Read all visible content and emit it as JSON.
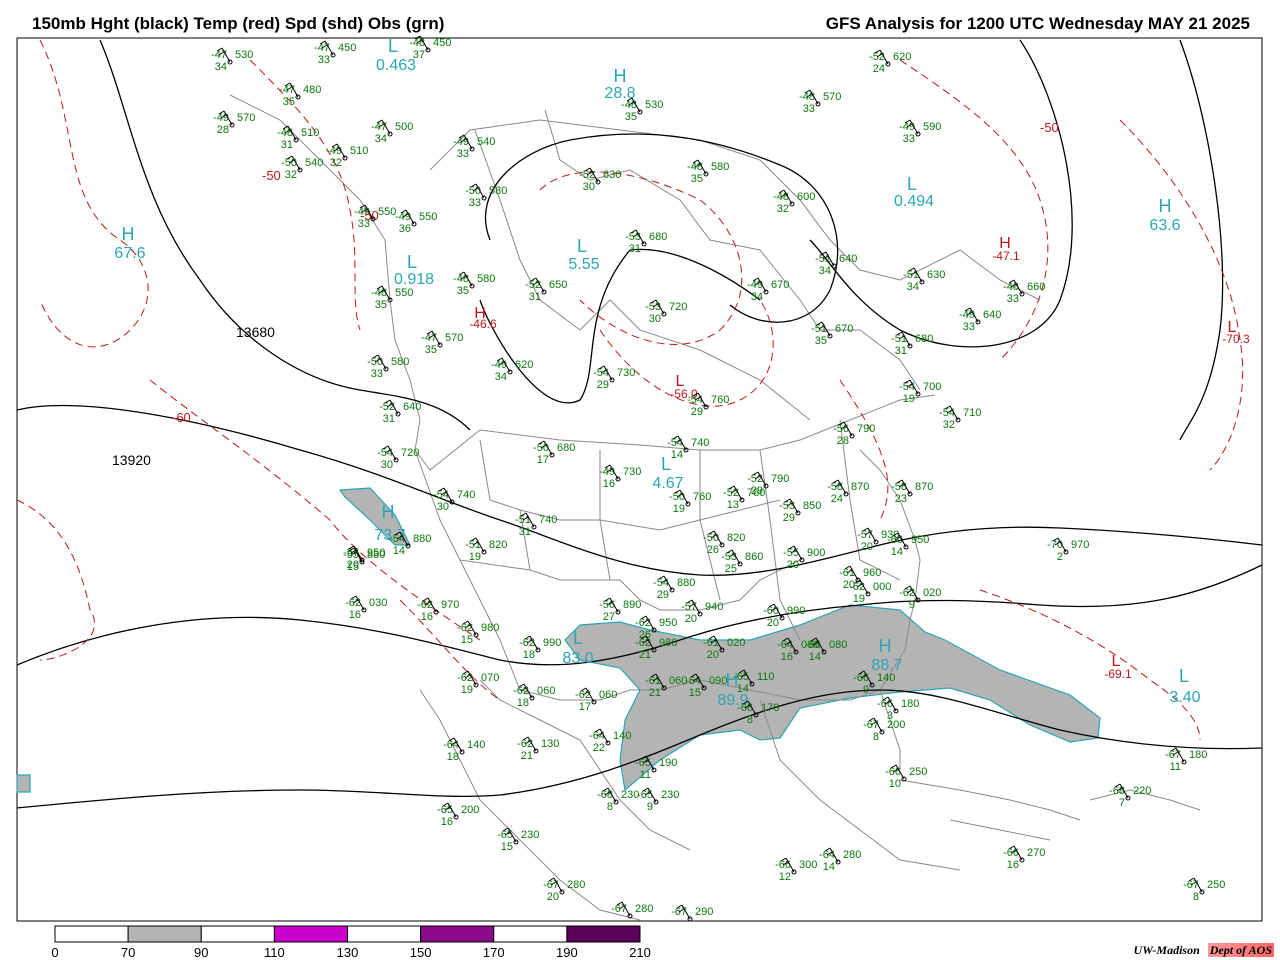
{
  "header": {
    "left_title": "150mb Hght (black) Temp (red) Spd (shd) Obs (grn)",
    "right_title": "GFS Analysis for 1200 UTC Wednesday  MAY 21 2025"
  },
  "contour_labels": [
    {
      "text": "13680"
    },
    {
      "text": "13920"
    }
  ],
  "temp_labels": [
    {
      "text": "-50"
    },
    {
      "text": "-50"
    },
    {
      "text": "-60"
    },
    {
      "text": "-50"
    }
  ],
  "centers": [
    {
      "letter": "H",
      "value": "67.6",
      "color": "#2aa6b4"
    },
    {
      "letter": "L",
      "value": "0.463",
      "color": "#2aa6b4"
    },
    {
      "letter": "H",
      "value": "28.8",
      "color": "#2aa6b4"
    },
    {
      "letter": "L",
      "value": "0.494",
      "color": "#2aa6b4"
    },
    {
      "letter": "H",
      "value": "63.6",
      "color": "#2aa6b4"
    },
    {
      "letter": "L",
      "value": "5.55",
      "color": "#2aa6b4"
    },
    {
      "letter": "L",
      "value": "0.918",
      "color": "#2aa6b4"
    },
    {
      "letter": "H",
      "value": "-46.6",
      "color": "#c01818"
    },
    {
      "letter": "H",
      "value": "-47.1",
      "color": "#c01818"
    },
    {
      "letter": "L",
      "value": "-70.3",
      "color": "#c01818"
    },
    {
      "letter": "L",
      "value": "-56.0",
      "color": "#c01818"
    },
    {
      "letter": "L",
      "value": "4.67",
      "color": "#2aa6b4"
    },
    {
      "letter": "H",
      "value": "73.7",
      "color": "#2aa6b4"
    },
    {
      "letter": "L",
      "value": "83.0",
      "color": "#2aa6b4"
    },
    {
      "letter": "H",
      "value": "89.9",
      "color": "#2aa6b4"
    },
    {
      "letter": "H",
      "value": "88.7",
      "color": "#2aa6b4"
    },
    {
      "letter": "L",
      "value": "-69.1",
      "color": "#c01818"
    },
    {
      "letter": "L",
      "value": "3.40",
      "color": "#2aa6b4"
    }
  ],
  "observations": [
    {
      "t": "-47",
      "h": "530",
      "s": "34"
    },
    {
      "t": "-47",
      "h": "450",
      "s": "33"
    },
    {
      "t": "-48",
      "h": "450",
      "s": "37"
    },
    {
      "t": "-47",
      "h": "480",
      "s": "35"
    },
    {
      "t": "-49",
      "h": "570",
      "s": "28"
    },
    {
      "t": "-48",
      "h": "510",
      "s": "31"
    },
    {
      "t": "-49",
      "h": "510",
      "s": "32"
    },
    {
      "t": "-50",
      "h": "540",
      "s": "32"
    },
    {
      "t": "-47",
      "h": "500",
      "s": "34"
    },
    {
      "t": "-49",
      "h": "540",
      "s": "33"
    },
    {
      "t": "-48",
      "h": "530",
      "s": "35"
    },
    {
      "t": "-52",
      "h": "620",
      "s": "24"
    },
    {
      "t": "-48",
      "h": "570",
      "s": "33"
    },
    {
      "t": "-49",
      "h": "590",
      "s": "33"
    },
    {
      "t": "-52",
      "h": "630",
      "s": "30"
    },
    {
      "t": "-48",
      "h": "580",
      "s": "35"
    },
    {
      "t": "-48",
      "h": "600",
      "s": "32"
    },
    {
      "t": "-50",
      "h": "580",
      "s": "33"
    },
    {
      "t": "-49",
      "h": "550",
      "s": "33"
    },
    {
      "t": "-49",
      "h": "550",
      "s": "36"
    },
    {
      "t": "-53",
      "h": "680",
      "s": "31"
    },
    {
      "t": "-51",
      "h": "640",
      "s": "34"
    },
    {
      "t": "-51",
      "h": "630",
      "s": "34"
    },
    {
      "t": "-48",
      "h": "660",
      "s": "33"
    },
    {
      "t": "-48",
      "h": "580",
      "s": "35"
    },
    {
      "t": "-52",
      "h": "650",
      "s": "31"
    },
    {
      "t": "-49",
      "h": "670",
      "s": "34"
    },
    {
      "t": "-48",
      "h": "550",
      "s": "35"
    },
    {
      "t": "-53",
      "h": "720",
      "s": "30"
    },
    {
      "t": "-49",
      "h": "640",
      "s": "33"
    },
    {
      "t": "-47",
      "h": "570",
      "s": "35"
    },
    {
      "t": "-51",
      "h": "670",
      "s": "35"
    },
    {
      "t": "-51",
      "h": "680",
      "s": "31"
    },
    {
      "t": "-50",
      "h": "580",
      "s": "33"
    },
    {
      "t": "-49",
      "h": "620",
      "s": "34"
    },
    {
      "t": "-54",
      "h": "730",
      "s": "29"
    },
    {
      "t": "-54",
      "h": "760",
      "s": "29"
    },
    {
      "t": "-54",
      "h": "700",
      "s": "19"
    },
    {
      "t": "-52",
      "h": "640",
      "s": "31"
    },
    {
      "t": "-54",
      "h": "710",
      "s": "32"
    },
    {
      "t": "-54",
      "h": "740",
      "s": "14"
    },
    {
      "t": "-56",
      "h": "790",
      "s": "28"
    },
    {
      "t": "-54",
      "h": "720",
      "s": "30"
    },
    {
      "t": "-50",
      "h": "680",
      "s": "17"
    },
    {
      "t": "-49",
      "h": "730",
      "s": "16"
    },
    {
      "t": "-54",
      "h": "740",
      "s": "30"
    },
    {
      "t": "-50",
      "h": "760",
      "s": "19"
    },
    {
      "t": "-52",
      "h": "780",
      "s": "13"
    },
    {
      "t": "-52",
      "h": "790",
      "s": "29"
    },
    {
      "t": "-58",
      "h": "870",
      "s": "24"
    },
    {
      "t": "-58",
      "h": "870",
      "s": "23"
    },
    {
      "t": "-51",
      "h": "740",
      "s": "31"
    },
    {
      "t": "-53",
      "h": "850",
      "s": "29"
    },
    {
      "t": "-54",
      "h": "880",
      "s": "14"
    },
    {
      "t": "-55",
      "h": "880",
      "s": "15"
    },
    {
      "t": "-51",
      "h": "820",
      "s": "19"
    },
    {
      "t": "-50",
      "h": "820",
      "s": "26"
    },
    {
      "t": "-53",
      "h": "860",
      "s": "25"
    },
    {
      "t": "-55",
      "h": "900",
      "s": "20"
    },
    {
      "t": "-57",
      "h": "930",
      "s": "20"
    },
    {
      "t": "-60",
      "h": "950",
      "s": "14"
    },
    {
      "t": "-70",
      "h": "970",
      "s": "2"
    },
    {
      "t": "-57",
      "h": "950",
      "s": "20"
    },
    {
      "t": "-54",
      "h": "880",
      "s": "29"
    },
    {
      "t": "-61",
      "h": "960",
      "s": "20"
    },
    {
      "t": "-62",
      "h": "030",
      "s": "16"
    },
    {
      "t": "-62",
      "h": "970",
      "s": "16"
    },
    {
      "t": "-56",
      "h": "890",
      "s": "27"
    },
    {
      "t": "-57",
      "h": "940",
      "s": "20"
    },
    {
      "t": "-60",
      "h": "990",
      "s": "20"
    },
    {
      "t": "-62",
      "h": "000",
      "s": "19"
    },
    {
      "t": "-62",
      "h": "020",
      "s": "9"
    },
    {
      "t": "-62",
      "h": "980",
      "s": "15"
    },
    {
      "t": "-62",
      "h": "950",
      "s": "26"
    },
    {
      "t": "-62",
      "h": "990",
      "s": "18"
    },
    {
      "t": "-62",
      "h": "980",
      "s": "21"
    },
    {
      "t": "-61",
      "h": "020",
      "s": "20"
    },
    {
      "t": "-64",
      "h": "080",
      "s": "16"
    },
    {
      "t": "-66",
      "h": "080",
      "s": "14"
    },
    {
      "t": "-62",
      "h": "070",
      "s": "19"
    },
    {
      "t": "-62",
      "h": "060",
      "s": "18"
    },
    {
      "t": "-62",
      "h": "060",
      "s": "17"
    },
    {
      "t": "-61",
      "h": "060",
      "s": "21"
    },
    {
      "t": "-64",
      "h": "090",
      "s": "15"
    },
    {
      "t": "-65",
      "h": "110",
      "s": "14"
    },
    {
      "t": "-66",
      "h": "140",
      "s": "9"
    },
    {
      "t": "-66",
      "h": "170",
      "s": "8"
    },
    {
      "t": "-66",
      "h": "180",
      "s": "3"
    },
    {
      "t": "-67",
      "h": "200",
      "s": "8"
    },
    {
      "t": "-64",
      "h": "140",
      "s": "18"
    },
    {
      "t": "-62",
      "h": "130",
      "s": "21"
    },
    {
      "t": "-64",
      "h": "140",
      "s": "22"
    },
    {
      "t": "-65",
      "h": "190",
      "s": "11"
    },
    {
      "t": "-66",
      "h": "250",
      "s": "10"
    },
    {
      "t": "-67",
      "h": "180",
      "s": "11"
    },
    {
      "t": "-68",
      "h": "220",
      "s": "7"
    },
    {
      "t": "-65",
      "h": "200",
      "s": "16"
    },
    {
      "t": "-68",
      "h": "230",
      "s": "8"
    },
    {
      "t": "-65",
      "h": "230",
      "s": "9"
    },
    {
      "t": "-65",
      "h": "230",
      "s": "15"
    },
    {
      "t": "-66",
      "h": "300",
      "s": "12"
    },
    {
      "t": "-64",
      "h": "280",
      "s": "14"
    },
    {
      "t": "-66",
      "h": "270",
      "s": "16"
    },
    {
      "t": "-67",
      "h": "280",
      "s": "20"
    },
    {
      "t": "-67",
      "h": "280",
      "s": ""
    },
    {
      "t": "-67",
      "h": "290",
      "s": ""
    },
    {
      "t": "-67",
      "h": "250",
      "s": "8"
    }
  ],
  "colorbar": {
    "ticks": [
      "0",
      "70",
      "90",
      "110",
      "130",
      "150",
      "170",
      "190",
      "210"
    ],
    "bins": [
      {
        "color": "#ffffff"
      },
      {
        "color": "#b4b4b4"
      },
      {
        "color": "#ffffff"
      },
      {
        "color": "#cc00cc"
      },
      {
        "color": "#ffffff"
      },
      {
        "color": "#8c0a8c"
      },
      {
        "color": "#ffffff"
      },
      {
        "color": "#5a005a"
      }
    ]
  },
  "credit": {
    "org": "UW-Madison",
    "dept": "Dept of AOS"
  },
  "colors": {
    "height": "#000000",
    "temp": "#c01818",
    "obs": "#0a7a0a",
    "jet_fill": "#b4b4b4",
    "jet_edge": "#2aa6b4",
    "boundary": "#8a8a8a"
  }
}
